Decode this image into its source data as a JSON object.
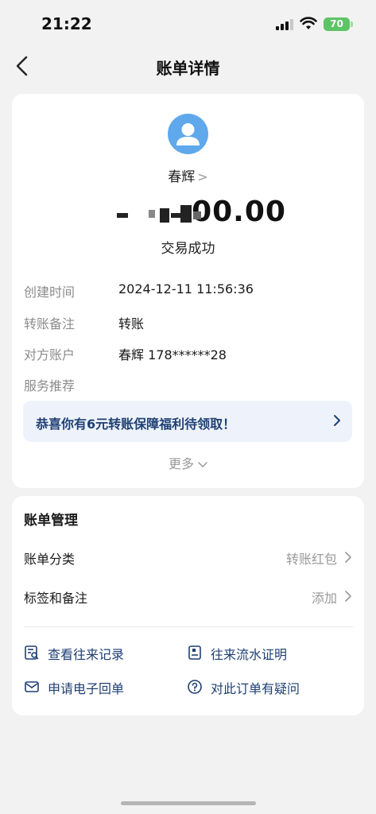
{
  "status_bar": {
    "time": "21:22",
    "battery": "70"
  },
  "nav": {
    "title": "账单详情"
  },
  "transaction": {
    "payee_name": "春辉",
    "amount": "00.00",
    "status": "交易成功",
    "details": [
      {
        "label": "创建时间",
        "value": "2024-12-11 11:56:36"
      },
      {
        "label": "转账备注",
        "value": "转账"
      },
      {
        "label": "对方账户",
        "value": "春辉 178******28"
      },
      {
        "label": "服务推荐",
        "value": ""
      }
    ],
    "promo_text": "恭喜你有6元转账保障福利待领取！",
    "more_label": "更多"
  },
  "management": {
    "title": "账单管理",
    "rows": [
      {
        "label": "账单分类",
        "value": "转账红包"
      },
      {
        "label": "标签和备注",
        "value": "添加"
      }
    ],
    "actions": [
      {
        "label": "查看往来记录",
        "icon": "search-record-icon"
      },
      {
        "label": "往来流水证明",
        "icon": "statement-doc-icon"
      },
      {
        "label": "申请电子回单",
        "icon": "mail-icon"
      },
      {
        "label": "对此订单有疑问",
        "icon": "question-icon"
      }
    ]
  },
  "colors": {
    "accent": "#1f3f73",
    "avatar": "#5fa8ec",
    "battery": "#5dc465"
  }
}
